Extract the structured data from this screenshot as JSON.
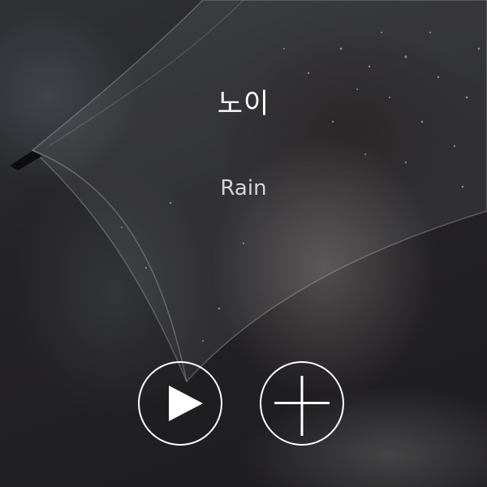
{
  "track": {
    "title": "노이",
    "artist": "Rain"
  },
  "controls": {
    "play_icon": "play-icon",
    "add_icon": "plus-icon"
  },
  "colors": {
    "text_primary": "#ffffff",
    "text_secondary": "#d6d6d6",
    "button_outline": "#ffffff"
  }
}
